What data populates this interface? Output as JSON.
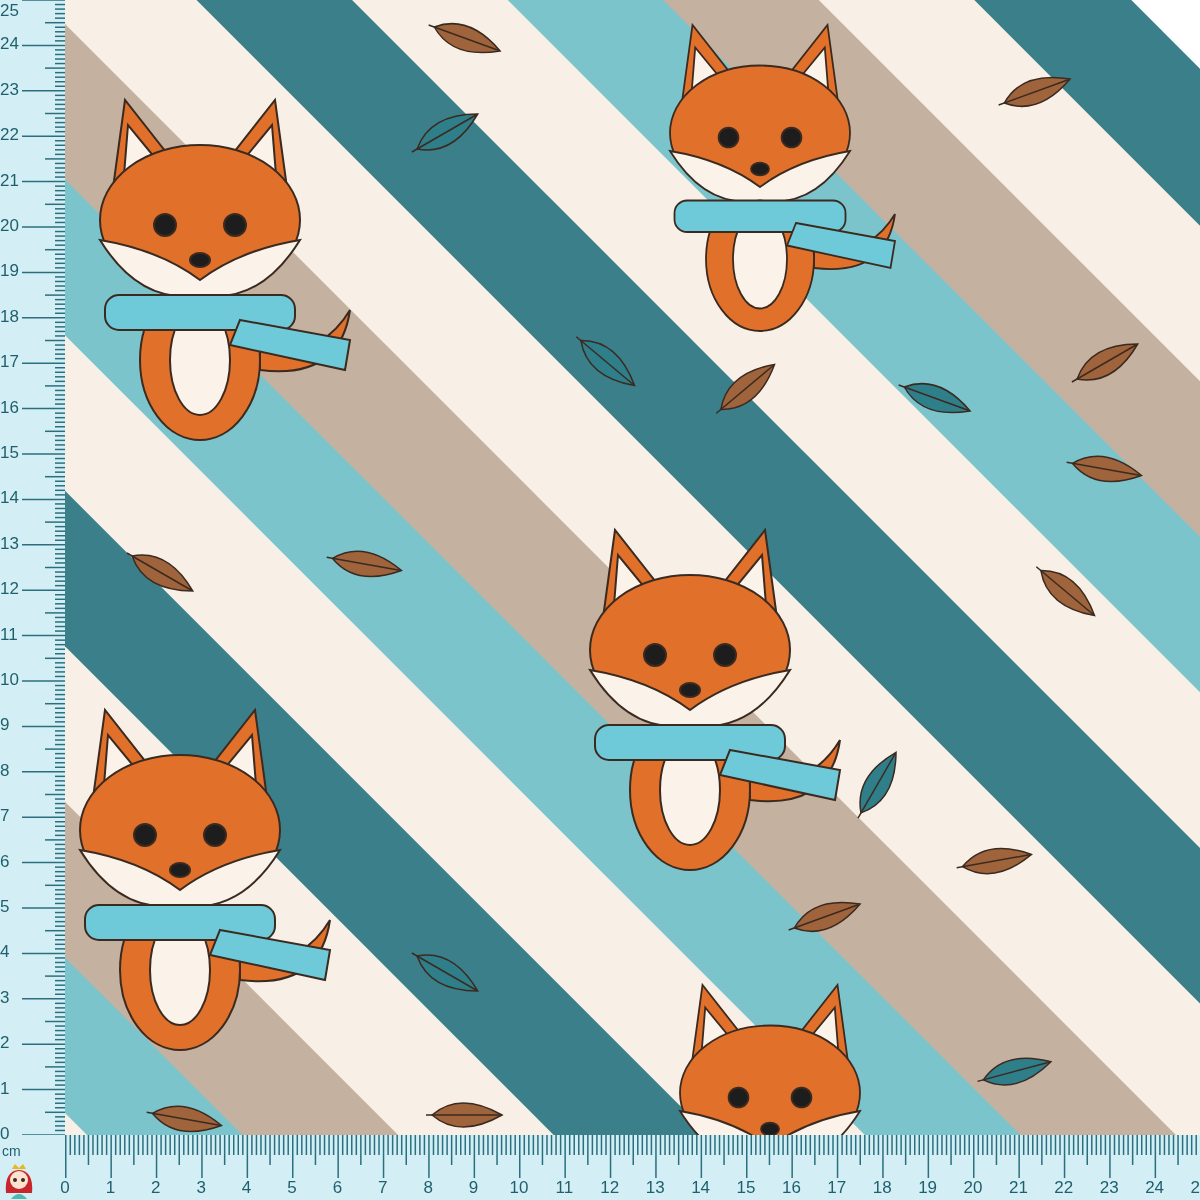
{
  "ruler": {
    "unit": "cm",
    "vertical_labels": [
      "25",
      "24",
      "23",
      "22",
      "21",
      "20",
      "19",
      "18",
      "17",
      "16",
      "15",
      "14",
      "13",
      "12",
      "11",
      "10",
      "9",
      "8",
      "7",
      "6",
      "5",
      "4",
      "3",
      "2",
      "1",
      "0"
    ],
    "horizontal_labels": [
      "0",
      "1",
      "2",
      "3",
      "4",
      "5",
      "6",
      "7",
      "8",
      "9",
      "10",
      "11",
      "12",
      "13",
      "14",
      "15",
      "16",
      "17",
      "18",
      "19",
      "20",
      "21",
      "22",
      "23",
      "24",
      "2"
    ]
  }
}
